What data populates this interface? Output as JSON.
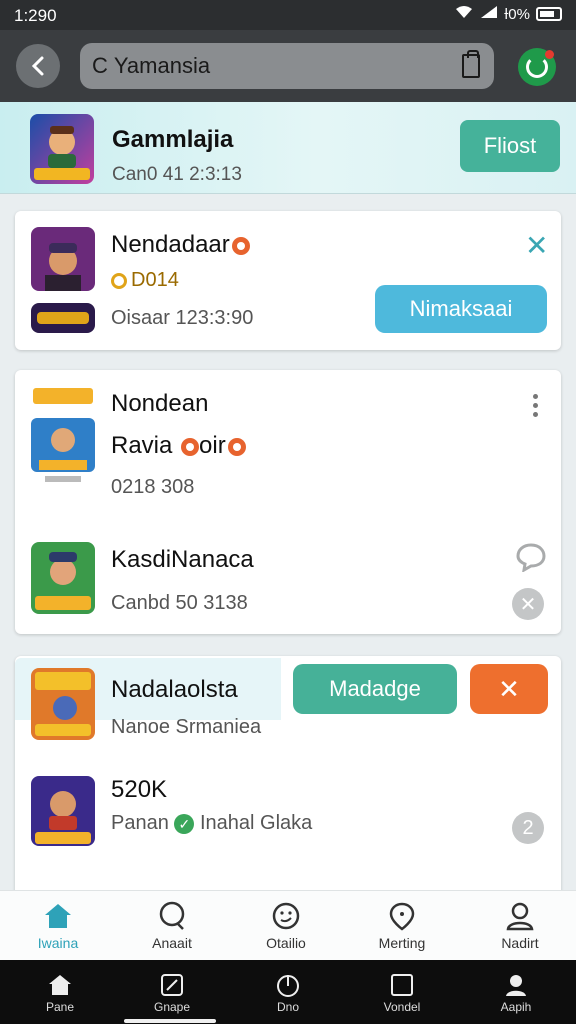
{
  "status_bar": {
    "time": "1:290",
    "battery": "Ɨ0%"
  },
  "top_bar": {
    "search_text": "Yamansia"
  },
  "header": {
    "title": "Gammlajia",
    "subtitle": "Can0 41 2:3:13",
    "button_label": "Fliost"
  },
  "card1": {
    "name": "Nendadaar",
    "points": "D014",
    "time": "Oisaar 123:3:90",
    "button_label": "Nimaksaai"
  },
  "card2": {
    "items": [
      {
        "name": "Nondean",
        "sub_title": "Ravia",
        "sub_title_suffix": "oir",
        "meta": "0218 308"
      },
      {
        "name": "KasdiNanaca",
        "meta": "Canbd 50 3138"
      }
    ]
  },
  "card3": {
    "items": [
      {
        "name": "Nadalaolsta",
        "meta": "Nanoe Srmaniea",
        "primary_label": "Madadge",
        "secondary_label": "✕"
      },
      {
        "name": "520K",
        "meta_prefix": "Panan",
        "meta_suffix": "Inahal Glaka",
        "badge": "2"
      }
    ]
  },
  "bottom_nav": [
    {
      "label": "Iwaina",
      "icon": "home-icon",
      "active": true
    },
    {
      "label": "Anaait",
      "icon": "chat-icon"
    },
    {
      "label": "Otailio",
      "icon": "smile-icon"
    },
    {
      "label": "Merting",
      "icon": "pin-icon"
    },
    {
      "label": "Nadirt",
      "icon": "person-icon"
    }
  ],
  "system_nav": [
    {
      "label": "Pane",
      "icon": "home-icon"
    },
    {
      "label": "Gnape",
      "icon": "edit-icon"
    },
    {
      "label": "Dno",
      "icon": "power-icon"
    },
    {
      "label": "Vondel",
      "icon": "square-icon"
    },
    {
      "label": "Aapih",
      "icon": "person-icon"
    }
  ],
  "colors": {
    "accent": "#2ea2b8",
    "teal_button": "#45b29a",
    "blue_button": "#4eb9dc",
    "orange_button": "#ee6f2e"
  }
}
